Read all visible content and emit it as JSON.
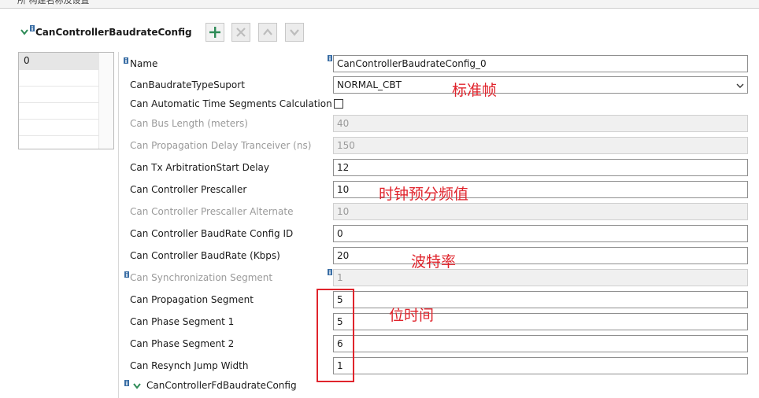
{
  "header": {
    "clipped_text": "所 构建名称及设置",
    "title": "CanControllerBaudrateConfig"
  },
  "list": {
    "items": [
      "0"
    ]
  },
  "fields": {
    "name": {
      "label": "Name",
      "value": "CanControllerBaudrateConfig_0"
    },
    "baudrate_type": {
      "label": "CanBaudrateTypeSuport",
      "value": "NORMAL_CBT"
    },
    "auto_time_seg": {
      "label": "Can Automatic Time Segments Calculation"
    },
    "bus_length": {
      "label": "Can Bus Length (meters)",
      "value": "40"
    },
    "prop_delay": {
      "label": "Can Propagation Delay Tranceiver (ns)",
      "value": "150"
    },
    "tx_arb_delay": {
      "label": "Can Tx ArbitrationStart Delay",
      "value": "12"
    },
    "prescaller": {
      "label": "Can Controller Prescaller",
      "value": "10"
    },
    "prescaller_alt": {
      "label": "Can Controller Prescaller Alternate",
      "value": "10"
    },
    "baud_config_id": {
      "label": "Can Controller BaudRate Config ID",
      "value": "0"
    },
    "baudrate_kbps": {
      "label": "Can Controller BaudRate (Kbps)",
      "value": "20"
    },
    "sync_seg": {
      "label": "Can Synchronization Segment",
      "value": "1"
    },
    "prop_seg": {
      "label": "Can Propagation Segment",
      "value": "5"
    },
    "phase_seg1": {
      "label": "Can Phase Segment 1",
      "value": "5"
    },
    "phase_seg2": {
      "label": "Can Phase Segment 2",
      "value": "6"
    },
    "resynch_jw": {
      "label": "Can Resynch Jump Width",
      "value": "1"
    }
  },
  "footer": {
    "label": "CanControllerFdBaudrateConfig"
  },
  "annotations": {
    "standard_frame": "标准帧",
    "clock_prescale": "时钟预分频值",
    "baud_rate": "波特率",
    "bit_time": "位时间"
  },
  "colors": {
    "accent": "#2e8b57",
    "annotation": "#e0242c",
    "info": "#3a6ea5"
  }
}
